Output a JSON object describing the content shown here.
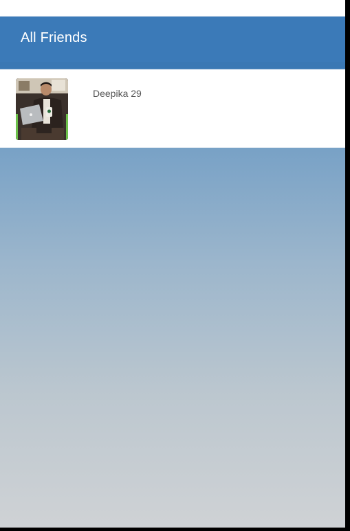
{
  "app_bar": {
    "title": "All Friends"
  },
  "friends": [
    {
      "name": "Deepika 29",
      "avatar_icon": "user-photo",
      "online_indicator_color": "#6cc04a"
    }
  ],
  "colors": {
    "app_bar": "#3b7ab8",
    "background_top": "#4a84bb",
    "background_bottom": "#cfd2d5"
  }
}
